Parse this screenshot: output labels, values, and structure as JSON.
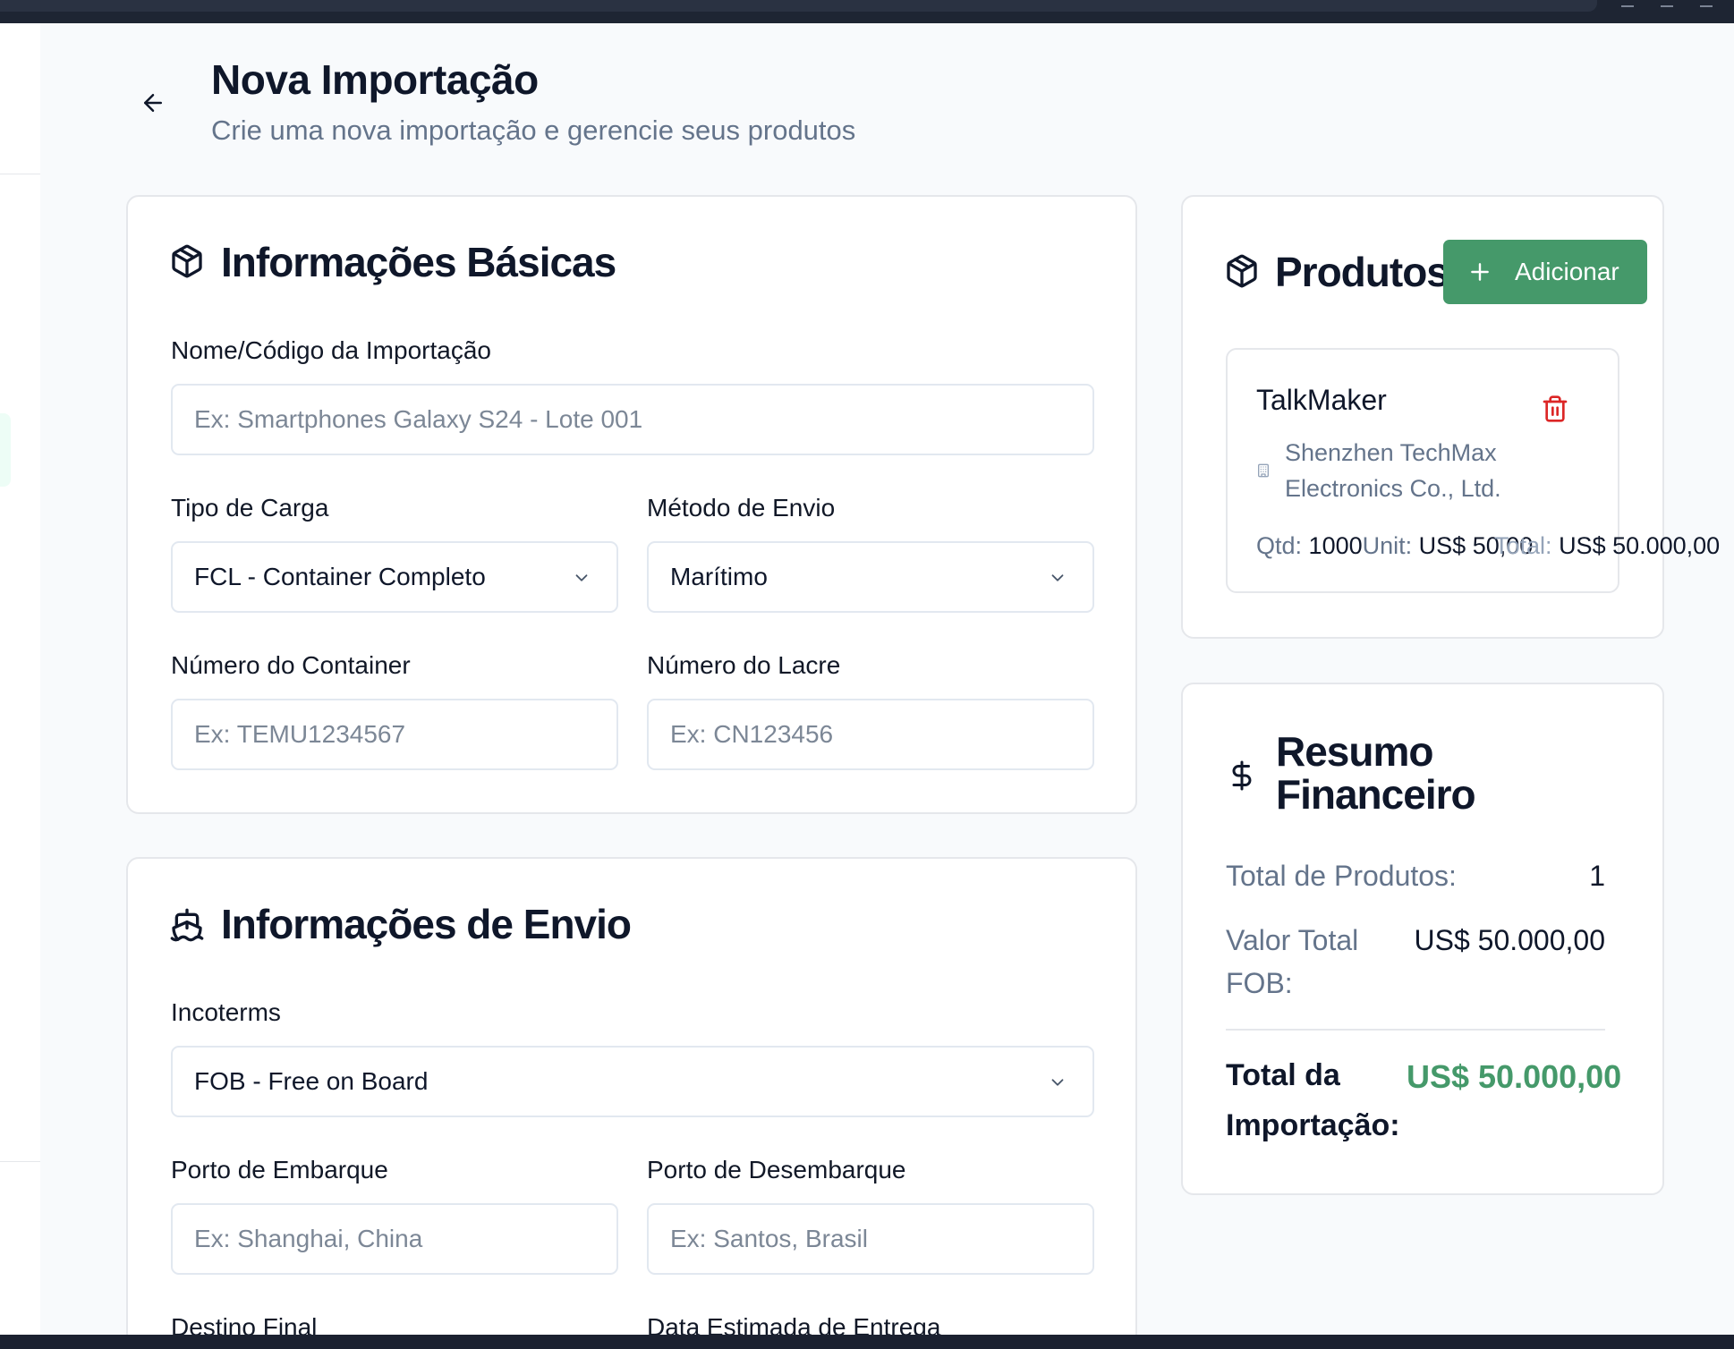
{
  "header": {
    "title": "Nova Importação",
    "subtitle": "Crie uma nova importação e gerencie seus produtos"
  },
  "basic_info": {
    "title": "Informações Básicas",
    "name_label": "Nome/Código da Importação",
    "name_placeholder": "Ex: Smartphones Galaxy S24 - Lote 001",
    "cargo_type_label": "Tipo de Carga",
    "cargo_type_value": "FCL - Container Completo",
    "shipping_method_label": "Método de Envio",
    "shipping_method_value": "Marítimo",
    "container_label": "Número do Container",
    "container_placeholder": "Ex: TEMU1234567",
    "seal_label": "Número do Lacre",
    "seal_placeholder": "Ex: CN123456"
  },
  "shipping_info": {
    "title": "Informações de Envio",
    "incoterms_label": "Incoterms",
    "incoterms_value": "FOB - Free on Board",
    "origin_port_label": "Porto de Embarque",
    "origin_port_placeholder": "Ex: Shanghai, China",
    "dest_port_label": "Porto de Desembarque",
    "dest_port_placeholder": "Ex: Santos, Brasil",
    "final_dest_label": "Destino Final",
    "delivery_date_label": "Data Estimada de Entrega"
  },
  "products": {
    "title": "Produtos",
    "add_label": "Adicionar",
    "items": [
      {
        "name": "TalkMaker",
        "supplier_line1": "Shenzhen TechMax",
        "supplier_line2": "Electronics Co., Ltd.",
        "qty_label": "Qtd:",
        "qty": "1000",
        "unit_label": "Unit:",
        "unit_price": "US$ 50,00",
        "total_label": "Total:",
        "total": "US$ 50.000,00"
      }
    ]
  },
  "summary": {
    "title_line1": "Resumo",
    "title_line2": "Financeiro",
    "total_products_label": "Total de Produtos:",
    "total_products_value": "1",
    "fob_label_line1": "Valor Total",
    "fob_label_line2": "FOB:",
    "fob_value": "US$ 50.000,00",
    "import_total_label_line1": "Total da",
    "import_total_label_line2": "Importação:",
    "import_total_value": "US$ 50.000,00"
  },
  "colors": {
    "accent_green": "#45996a",
    "danger_red": "#dc2626",
    "text_dark": "#0f172a",
    "text_muted": "#64748b"
  }
}
